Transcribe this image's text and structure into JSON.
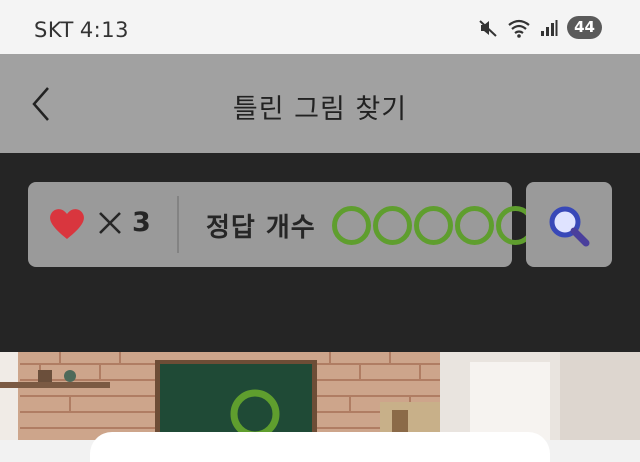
{
  "status_bar": {
    "carrier": "SKT",
    "time": "4:13",
    "battery": "44",
    "icons": [
      "mute-icon",
      "wifi-icon",
      "signal-icon",
      "battery-icon"
    ]
  },
  "app_bar": {
    "title": "틀린 그림 찾기",
    "back_icon": "chevron-left-icon"
  },
  "game_status": {
    "lives_icon": "heart-icon",
    "times_symbol": "×",
    "lives": "3",
    "answer_label": "정답 개수",
    "answers_total": 5,
    "hint_icon": "search-icon"
  },
  "colors": {
    "heart": "#d9363e",
    "circle": "#5f9e2e",
    "search": "#3848b8",
    "panel": "#252525",
    "app_bar": "#a1a1a1"
  }
}
